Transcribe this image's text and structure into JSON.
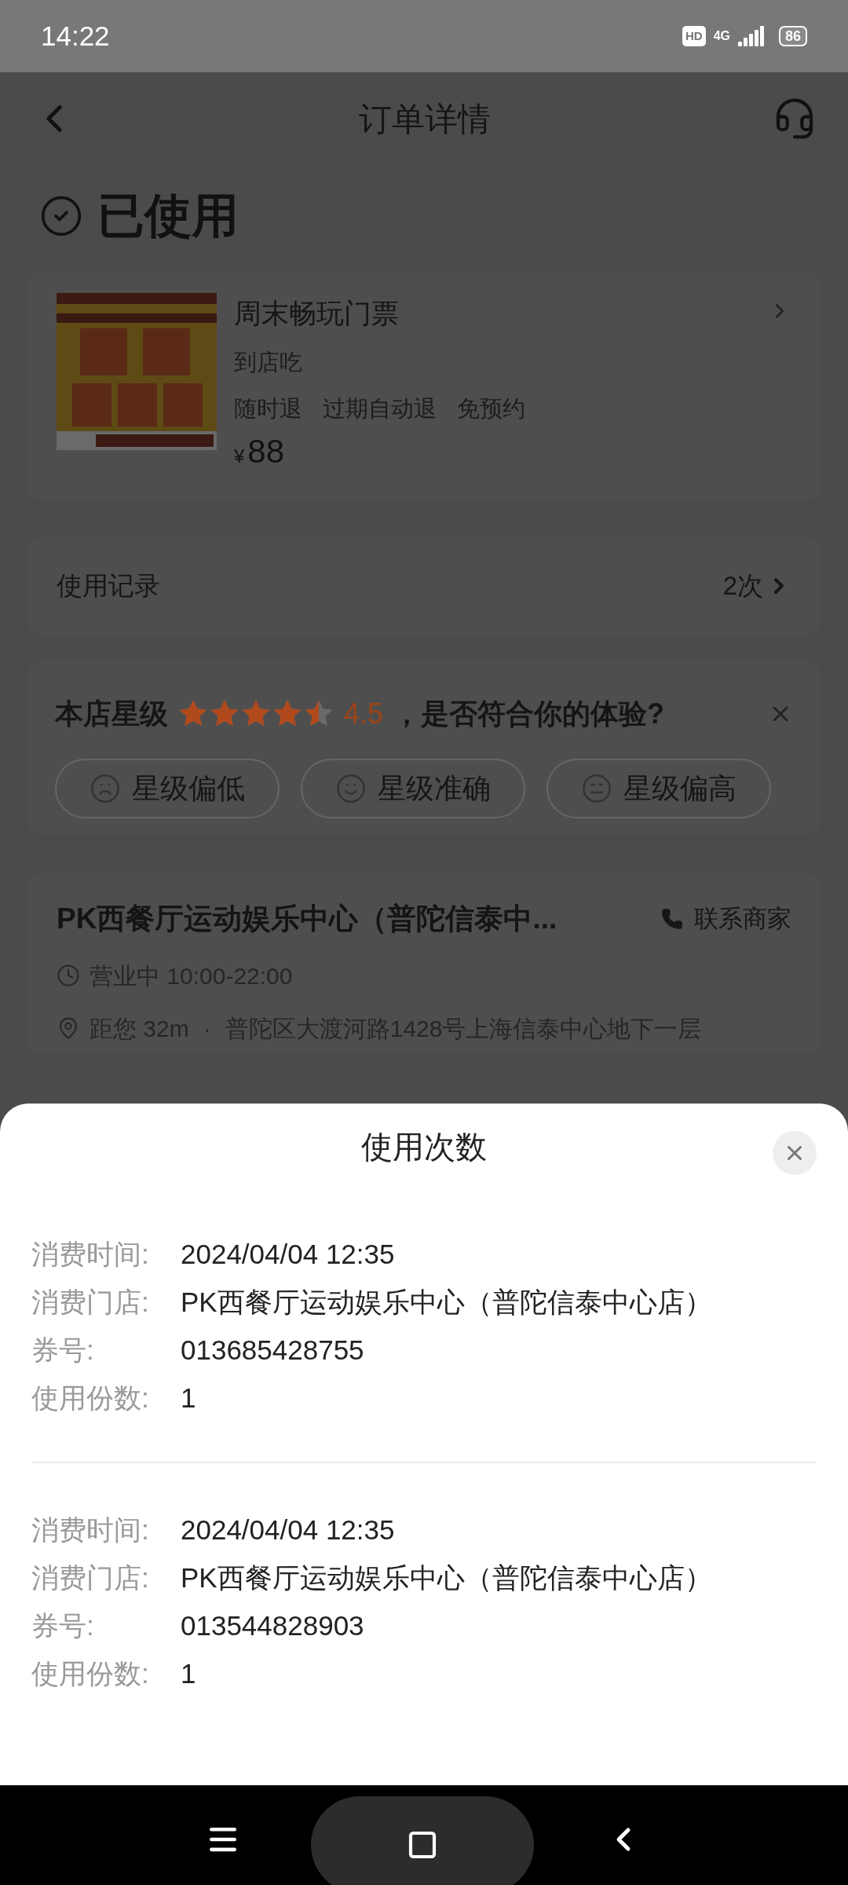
{
  "status_bar": {
    "time": "14:22",
    "hd_badge": "HD",
    "network": "4G",
    "battery": "86"
  },
  "header": {
    "title": "订单详情"
  },
  "order_status": {
    "label": "已使用"
  },
  "product": {
    "title": "周末畅玩门票",
    "subtitle": "到店吃",
    "tags": [
      "随时退",
      "过期自动退",
      "免预约"
    ],
    "currency": "¥",
    "price": "88"
  },
  "usage_record": {
    "label": "使用记录",
    "count": "2次"
  },
  "rating_prompt": {
    "label": "本店星级",
    "stars": 4.5,
    "score": "4.5",
    "question": "，是否符合你的体验?",
    "options": [
      {
        "label": "星级偏低",
        "kind": "low"
      },
      {
        "label": "星级准确",
        "kind": "accurate"
      },
      {
        "label": "星级偏高",
        "kind": "high"
      }
    ]
  },
  "store": {
    "name": "PK西餐厅运动娱乐中心（普陀信泰中...",
    "contact": "联系商家",
    "hours": "营业中 10:00-22:00",
    "distance": "距您 32m",
    "separator": "·",
    "address": "普陀区大渡河路1428号上海信泰中心地下一层"
  },
  "sheet": {
    "title": "使用次数",
    "records": [
      {
        "fields": [
          {
            "label": "消费时间:",
            "value": "2024/04/04 12:35"
          },
          {
            "label": "消费门店:",
            "value": "PK西餐厅运动娱乐中心（普陀信泰中心店）"
          },
          {
            "label": "券号:",
            "value": "013685428755"
          },
          {
            "label": "使用份数:",
            "value": "1"
          }
        ]
      },
      {
        "fields": [
          {
            "label": "消费时间:",
            "value": "2024/04/04 12:35"
          },
          {
            "label": "消费门店:",
            "value": "PK西餐厅运动娱乐中心（普陀信泰中心店）"
          },
          {
            "label": "券号:",
            "value": "013544828903"
          },
          {
            "label": "使用份数:",
            "value": "1"
          }
        ]
      }
    ]
  }
}
